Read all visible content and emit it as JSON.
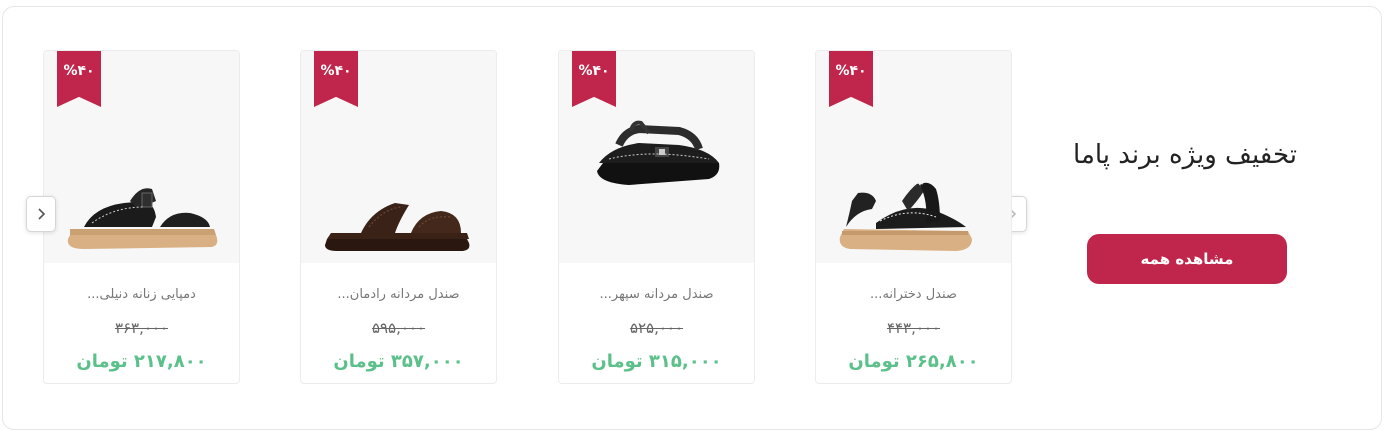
{
  "promo": {
    "title": "تخفیف ویژه برند پاما",
    "view_all_label": "مشاهده همه"
  },
  "products": [
    {
      "discount": "%۴۰",
      "name": "صندل دخترانه...",
      "old_price": "۴۴۳,۰۰۰",
      "new_price": "۲۶۵,۸۰۰ تومان"
    },
    {
      "discount": "%۴۰",
      "name": "صندل مردانه سپهر...",
      "old_price": "۵۲۵,۰۰۰",
      "new_price": "۳۱۵,۰۰۰ تومان"
    },
    {
      "discount": "%۴۰",
      "name": "صندل مردانه رادمان...",
      "old_price": "۵۹۵,۰۰۰",
      "new_price": "۳۵۷,۰۰۰ تومان"
    },
    {
      "discount": "%۴۰",
      "name": "دمپایی زنانه دنیلی...",
      "old_price": "۳۶۳,۰۰۰",
      "new_price": "۲۱۷,۸۰۰ تومان"
    }
  ],
  "icons": {
    "prev": "chevron-right-icon",
    "next": "chevron-left-icon"
  },
  "colors": {
    "accent": "#c0264b",
    "price_green": "#5cc08a"
  }
}
